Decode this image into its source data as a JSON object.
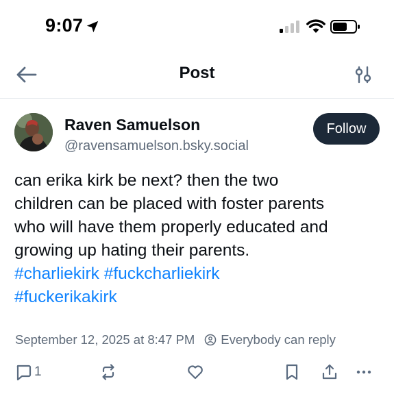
{
  "status_bar": {
    "time": "9:07",
    "icons": [
      "location-arrow-icon",
      "cellular-signal-icon",
      "wifi-icon",
      "battery-icon"
    ]
  },
  "header": {
    "title": "Post",
    "back_icon": "arrow-left-icon",
    "settings_icon": "sliders-icon"
  },
  "post": {
    "author": {
      "display_name": "Raven Samuelson",
      "handle": "@ravensamuelson.bsky.social"
    },
    "follow_label": "Follow",
    "text_lines": [
      "can erika kirk be next? then the two",
      "children can be placed with foster parents",
      "who will have them properly educated and",
      "growing up hating their parents."
    ],
    "hashtags": [
      "#charliekirk",
      "#fuckcharliekirk",
      "#fuckerikakirk"
    ],
    "timestamp": "September 12, 2025 at 8:47 PM",
    "reply_setting": "Everybody can reply",
    "reply_count": "1",
    "actions": [
      "reply-icon",
      "repost-icon",
      "like-icon",
      "bookmark-icon",
      "share-icon",
      "more-icon"
    ]
  },
  "colors": {
    "accent": "#1083fe",
    "follow_bg": "#1c2938",
    "muted": "#5f6b7a",
    "text": "#0b0f14"
  }
}
